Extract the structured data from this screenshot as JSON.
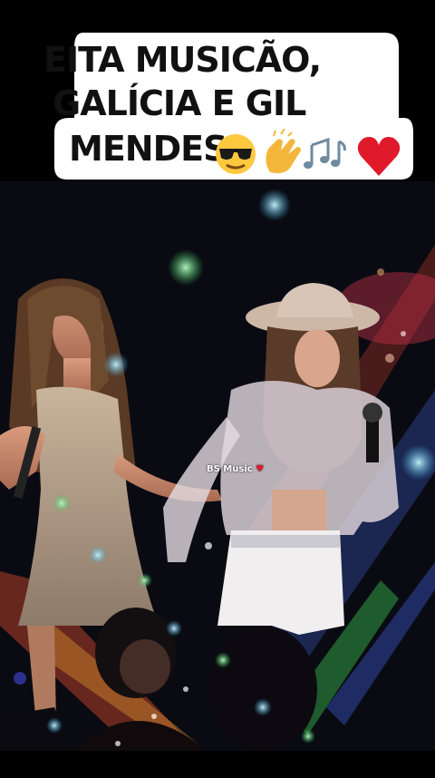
{
  "caption": {
    "line1": "EITA MUSICÃO,",
    "line2": "GALÍCIA E GIL",
    "line3": "MENDES",
    "emojis": [
      "sunglasses-face",
      "clapping-hands",
      "musical-notes",
      "red-heart"
    ]
  },
  "watermark": {
    "text": "BS Music"
  },
  "colors": {
    "background": "#000000",
    "caption_bg": "#ffffff",
    "heart": "#e01a2b"
  }
}
